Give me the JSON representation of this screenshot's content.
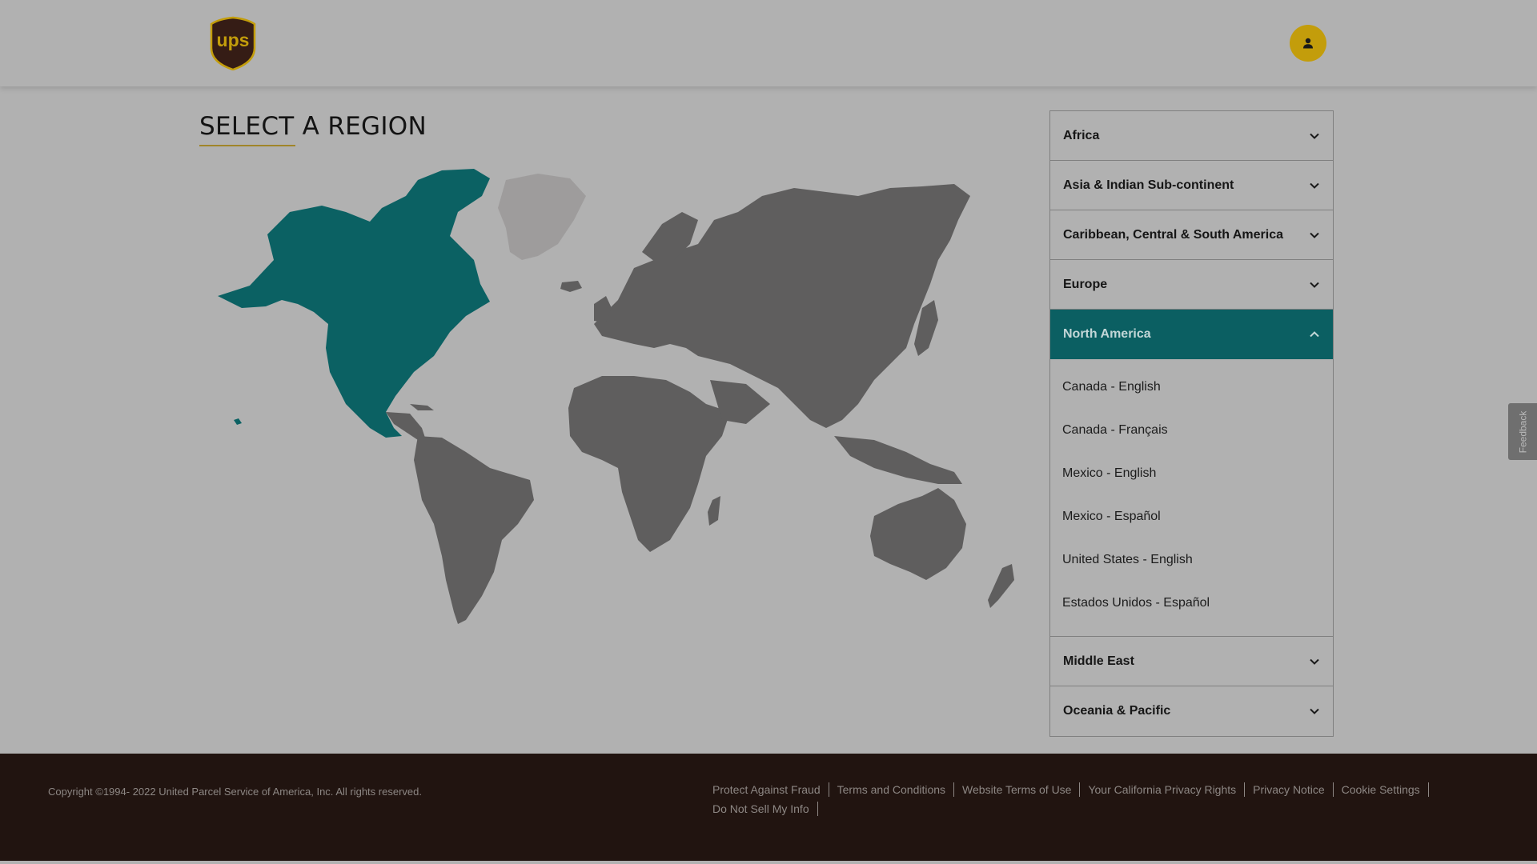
{
  "header": {
    "logo_icon": "ups-shield-logo",
    "account_icon": "person-icon",
    "colors": {
      "brand_gold": "#c39d0b",
      "brand_brown": "#351c15"
    }
  },
  "main": {
    "title": "SELECT A REGION",
    "map": {
      "highlighted_region": "North America",
      "colors": {
        "highlight": "#0b6163",
        "land": "#5f5e5e",
        "greenland": "#9e9c9c"
      }
    }
  },
  "regions": [
    {
      "label": "Africa",
      "expanded": false
    },
    {
      "label": "Asia & Indian Sub-continent",
      "expanded": false
    },
    {
      "label": "Caribbean, Central & South America",
      "expanded": false
    },
    {
      "label": "Europe",
      "expanded": false
    },
    {
      "label": "North America",
      "expanded": true,
      "countries": [
        "Canada - English",
        "Canada - Français",
        "Mexico - English",
        "Mexico - Español",
        "United States - English",
        "Estados Unidos - Español"
      ]
    },
    {
      "label": "Middle East",
      "expanded": false
    },
    {
      "label": "Oceania & Pacific",
      "expanded": false
    }
  ],
  "feedback": {
    "label": "Feedback"
  },
  "footer": {
    "copyright": "Copyright ©1994- 2022  United Parcel Service of America, Inc. All rights reserved.",
    "links": [
      "Protect Against Fraud",
      "Terms and Conditions",
      "Website Terms of Use",
      "Your California Privacy Rights",
      "Privacy Notice",
      "Cookie Settings",
      "Do Not Sell My Info"
    ]
  }
}
